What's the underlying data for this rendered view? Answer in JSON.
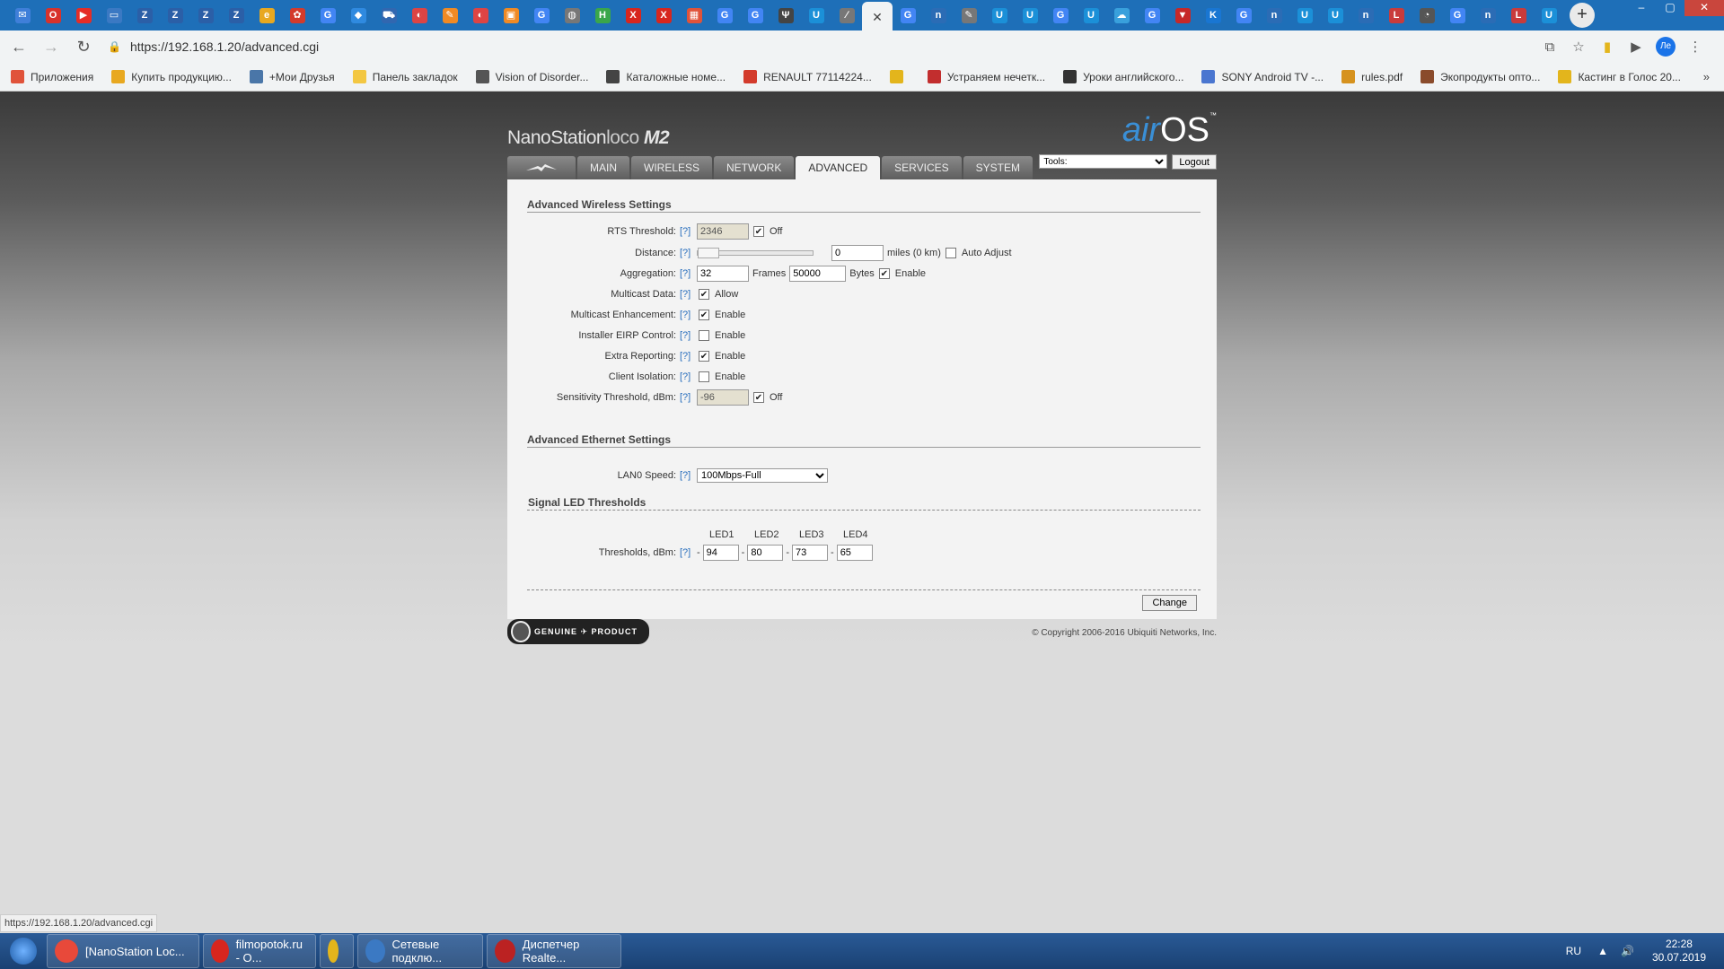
{
  "browser": {
    "address": "https://192.168.1.20/advanced.cgi",
    "active_tab_close": "✕",
    "bookmarks": [
      {
        "label": "Приложения",
        "color": "#e0533a"
      },
      {
        "label": "Купить продукцию...",
        "color": "#e8a820"
      },
      {
        "label": "+Мои Друзья",
        "color": "#4a76a8"
      },
      {
        "label": "Панель закладок",
        "color": "#f3c742"
      },
      {
        "label": "Vision of Disorder...",
        "color": "#555555"
      },
      {
        "label": "Каталожные номе...",
        "color": "#444444"
      },
      {
        "label": "RENAULT 77114224...",
        "color": "#d33b2c"
      },
      {
        "label": "",
        "color": "#e3b51c"
      },
      {
        "label": "Устраняем нечетк...",
        "color": "#c22e2e"
      },
      {
        "label": "Уроки английского...",
        "color": "#333333"
      },
      {
        "label": "SONY Android TV -...",
        "color": "#4a76d0"
      },
      {
        "label": "rules.pdf",
        "color": "#d6921e"
      },
      {
        "label": "Экопродукты опто...",
        "color": "#8a4b2b"
      },
      {
        "label": "Кастинг в Голос 20...",
        "color": "#e3b51c"
      }
    ],
    "bookmarks_more": "»",
    "status_url": "https://192.168.1.20/advanced.cgi",
    "avatar": "Ле"
  },
  "airos": {
    "product_prefix": "NanoStation",
    "product_mid": "loco",
    "product_suffix": "M2",
    "brand_air": "air",
    "brand_os": "OS",
    "brand_tm": "™",
    "tabs": [
      "MAIN",
      "WIRELESS",
      "NETWORK",
      "ADVANCED",
      "SERVICES",
      "SYSTEM"
    ],
    "tools_label": "Tools:",
    "logout": "Logout"
  },
  "wireless": {
    "title": "Advanced Wireless Settings",
    "help": "[?]",
    "rts_label": "RTS Threshold:",
    "rts_value": "2346",
    "rts_off": "Off",
    "distance_label": "Distance:",
    "distance_value": "0",
    "distance_unit": "miles (0 km)",
    "auto_adjust": "Auto Adjust",
    "aggregation_label": "Aggregation:",
    "aggregation_frames": "32",
    "frames_label": "Frames",
    "aggregation_bytes": "50000",
    "bytes_label": "Bytes",
    "aggregation_enable": "Enable",
    "multicast_label": "Multicast Data:",
    "multicast_allow": "Allow",
    "mc_enh_label": "Multicast Enhancement:",
    "eirp_label": "Installer EIRP Control:",
    "extra_label": "Extra Reporting:",
    "isolation_label": "Client Isolation:",
    "enable": "Enable",
    "sens_label": "Sensitivity Threshold, dBm:",
    "sens_value": "-96",
    "sens_off": "Off"
  },
  "ethernet": {
    "title": "Advanced Ethernet Settings",
    "lan_label": "LAN0 Speed:",
    "lan_value": "100Mbps-Full"
  },
  "led": {
    "title": "Signal LED Thresholds",
    "headers": [
      "LED1",
      "LED2",
      "LED3",
      "LED4"
    ],
    "label": "Thresholds, dBm:",
    "dash": "-",
    "values": [
      "94",
      "80",
      "73",
      "65"
    ]
  },
  "footer": {
    "change": "Change",
    "genuine": "GENUINE ✈ PRODUCT",
    "copyright": "© Copyright 2006-2016 Ubiquiti Networks, Inc."
  },
  "taskbar": {
    "items": [
      "[NanoStation Loc...",
      "filmopotok.ru - O...",
      "",
      "Сетевые подклю...",
      "Диспетчер Realte..."
    ],
    "lang": "RU",
    "time": "22:28",
    "date": "30.07.2019"
  }
}
